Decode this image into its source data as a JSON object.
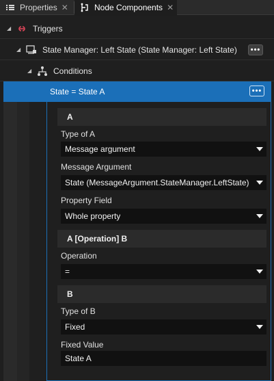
{
  "tabs": [
    {
      "label": "Properties",
      "icon": "list-icon",
      "close": "✕"
    },
    {
      "label": "Node Components",
      "icon": "node-components-icon",
      "close": "✕"
    }
  ],
  "tree": {
    "triggers": {
      "label": "Triggers",
      "icon": "trigger-link-icon"
    },
    "state_manager": {
      "label": "State Manager: Left State (State Manager: Left State)",
      "icon": "state-manager-icon",
      "menu": "•••"
    },
    "conditions": {
      "label": "Conditions",
      "icon": "conditions-tree-icon"
    },
    "condition": {
      "label": "State = State A",
      "menu": "•••"
    }
  },
  "sections": {
    "a": {
      "title": "A",
      "type_label": "Type of A",
      "type_value": "Message argument",
      "message_argument_label": "Message Argument",
      "message_argument_value": "State (MessageArgument.StateManager.LeftState)",
      "property_field_label": "Property Field",
      "property_field_value": "Whole property"
    },
    "operation": {
      "title": "A [Operation] B",
      "label": "Operation",
      "value": "="
    },
    "b": {
      "title": "B",
      "type_label": "Type of B",
      "type_value": "Fixed",
      "fixed_value_label": "Fixed Value",
      "fixed_value": "State A"
    }
  },
  "colors": {
    "selection": "#1b6fb8",
    "trigger_icon": "#e0475a"
  }
}
